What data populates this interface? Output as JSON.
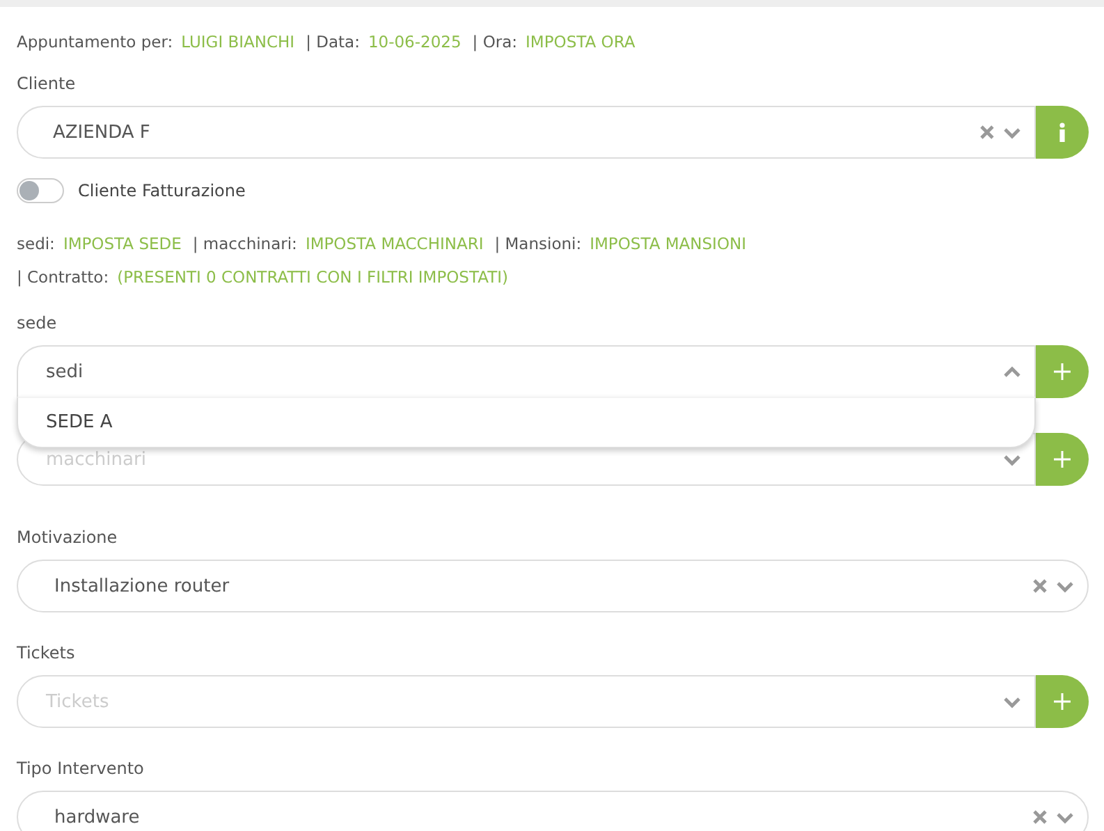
{
  "header": [
    {
      "label": "Appuntamento per:",
      "value": "LUIGI BIANCHI"
    },
    {
      "label": "| Data:",
      "value": "10-06-2025"
    },
    {
      "label": "| Ora:",
      "value": "IMPOSTA ORA"
    }
  ],
  "cliente": {
    "label": "Cliente",
    "value": "AZIENDA F",
    "clearable": true,
    "expanded": false,
    "kind": "info"
  },
  "toggle": {
    "label": "Cliente Fatturazione",
    "on": false
  },
  "filters": [
    {
      "label": "sedi:",
      "value": "IMPOSTA SEDE"
    },
    {
      "label": "| macchinari:",
      "value": "IMPOSTA MACCHINARI"
    },
    {
      "label": "| Mansioni:",
      "value": "IMPOSTA MANSIONI"
    },
    {
      "label": "| Contratto:",
      "value": "(PRESENTI 0 CONTRATTI CON I FILTRI IMPOSTATI)"
    }
  ],
  "fields": [
    {
      "label": "sede",
      "value": "sedi",
      "clearable": false,
      "expanded": true,
      "kind": "add",
      "options": [
        "SEDE A"
      ]
    },
    {
      "placeholder": "macchinari",
      "clearable": false,
      "expanded": false,
      "kind": "add"
    },
    {
      "label": "Motivazione",
      "value": "Installazione router",
      "clearable": true,
      "expanded": false,
      "kind": "plain"
    },
    {
      "label": "Tickets",
      "placeholder": "Tickets",
      "clearable": false,
      "expanded": false,
      "kind": "add"
    },
    {
      "label": "Tipo Intervento",
      "value": "hardware",
      "clearable": true,
      "expanded": false,
      "kind": "plain"
    }
  ]
}
